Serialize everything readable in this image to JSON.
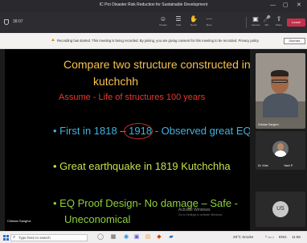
{
  "window": {
    "title": "IC Pro Disaster Risk Reduction for Sustainable Development",
    "controls": [
      "—",
      "▢",
      "✕"
    ]
  },
  "toolbar": {
    "timer": "38:07",
    "items": [
      {
        "icon": "☺",
        "label": "People"
      },
      {
        "icon": "☰",
        "label": "Chat"
      },
      {
        "icon": "✋",
        "label": "React"
      },
      {
        "icon": "⋯",
        "label": "More"
      },
      {
        "icon": "▣",
        "label": "Camera"
      },
      {
        "icon": "🎤",
        "label": "Mic"
      },
      {
        "icon": "⇪",
        "label": "Share"
      }
    ],
    "leave_label": "Leave"
  },
  "banner": {
    "message": "Recording has started. This meeting is being recorded. By joining, you are giving consent for this meeting to be recorded. Privacy policy",
    "dismiss": "Dismiss"
  },
  "slide": {
    "title_line1": "Compare two structure constructed in",
    "title_line2": "kutchchh",
    "assume": "Assume - Life of structures 100 years",
    "bullet1_pre": "First in 1818 – ",
    "bullet1_circled": "1918",
    "bullet1_post": " - Observed great EQ",
    "bullet2": "Great earthquake in 1819 Kutchchha",
    "bullet3_line1": "EQ Proof Design- No damage – Safe -",
    "bullet3_line2": "Uneconomical",
    "watermark_line1": "Activate Windows",
    "watermark_line2": "Go to Settings to activate Windows.",
    "presenter": "Chintan Sanghvi",
    "colors": {
      "title": "#f5c24e",
      "assume": "#e63a2d",
      "bullet1": "#3fb3dd",
      "bullet2": "#c8e049",
      "bullet3": "#8ed13a"
    }
  },
  "participants": [
    {
      "name": "Chintan Sanghvi"
    },
    {
      "name": "Dr. Kher",
      "name2": "Yash P."
    },
    {
      "initials": "US"
    }
  ],
  "taskbar": {
    "search_placeholder": "Type here to search",
    "tray_weather": "29°C Smoke",
    "tray_time": "11:56",
    "tray_lang": "ENG"
  }
}
